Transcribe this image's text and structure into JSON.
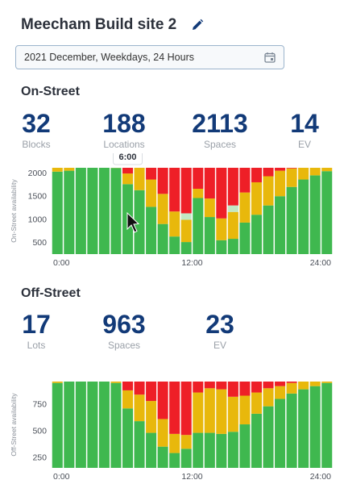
{
  "site": {
    "title": "Meecham Build site 2",
    "edit_icon": "pencil-icon"
  },
  "date_filter": {
    "value": "2021 December, Weekdays, 24 Hours",
    "icon": "calendar-icon"
  },
  "on_street": {
    "heading": "On-Street",
    "stats": [
      {
        "value": "32",
        "label": "Blocks"
      },
      {
        "value": "188",
        "label": "Locations"
      },
      {
        "value": "2113",
        "label": "Spaces"
      },
      {
        "value": "14",
        "label": "EV"
      }
    ],
    "tooltip": "6:00"
  },
  "off_street": {
    "heading": "Off-Street",
    "stats": [
      {
        "value": "17",
        "label": "Lots"
      },
      {
        "value": "963",
        "label": "Spaces"
      },
      {
        "value": "23",
        "label": "EV"
      }
    ]
  },
  "colors": {
    "green": "#3fb84f",
    "yellow": "#e8b80c",
    "red": "#ee1f27",
    "pink": "#f4b6bb",
    "lightgreen": "#c2e8c4",
    "navy": "#123a78"
  },
  "chart_data": [
    {
      "type": "bar",
      "stacked": true,
      "ylabel": "On-Street availability",
      "ylim": [
        250,
        2113
      ],
      "yticks": [
        500,
        1000,
        1500,
        2000
      ],
      "xticks": [
        "0:00",
        "12:00",
        "24:00"
      ],
      "categories": [
        "0",
        "1",
        "2",
        "3",
        "4",
        "5",
        "6",
        "7",
        "8",
        "9",
        "10",
        "11",
        "12",
        "13",
        "14",
        "15",
        "16",
        "17",
        "18",
        "19",
        "20",
        "21",
        "22",
        "23"
      ],
      "series": [
        {
          "values": [
            1780,
            1800,
            1890,
            1910,
            1890,
            1860,
            1510,
            1380,
            1020,
            650,
            380,
            260,
            1210,
            800,
            300,
            330,
            680,
            850,
            1050,
            1250,
            1450,
            1610,
            1700,
            1790
          ]
        },
        {
          "values": [
            100,
            90,
            90,
            100,
            100,
            120,
            230,
            510,
            590,
            650,
            540,
            480,
            200,
            400,
            470,
            580,
            650,
            700,
            630,
            550,
            400,
            260,
            190,
            120
          ]
        },
        {
          "values": [
            0,
            0,
            40,
            0,
            0,
            0,
            0,
            0,
            0,
            0,
            0,
            140,
            0,
            0,
            0,
            140,
            0,
            0,
            0,
            0,
            0,
            0,
            0,
            0
          ]
        },
        {
          "values": [
            43,
            63,
            33,
            73,
            73,
            83,
            373,
            223,
            503,
            813,
            1193,
            1233,
            703,
            913,
            1343,
            1063,
            783,
            563,
            433,
            313,
            263,
            243,
            223,
            203
          ]
        },
        {
          "values": [
            190,
            160,
            60,
            30,
            50,
            50,
            0,
            0,
            0,
            0,
            0,
            0,
            0,
            0,
            0,
            0,
            0,
            0,
            0,
            0,
            0,
            0,
            0,
            0
          ]
        }
      ]
    },
    {
      "type": "bar",
      "stacked": true,
      "ylabel": "Off-Street availability",
      "ylim": [
        150,
        963
      ],
      "yticks": [
        250,
        500,
        750,
        1000
      ],
      "xticks": [
        "0:00",
        "12:00",
        "24:00"
      ],
      "categories": [
        "0",
        "1",
        "2",
        "3",
        "4",
        "5",
        "6",
        "7",
        "8",
        "9",
        "10",
        "11",
        "12",
        "13",
        "14",
        "15",
        "16",
        "17",
        "18",
        "19",
        "20",
        "21",
        "22",
        "23"
      ],
      "series": [
        {
          "values": [
            800,
            830,
            850,
            850,
            850,
            800,
            560,
            440,
            330,
            200,
            140,
            180,
            330,
            330,
            320,
            340,
            410,
            510,
            580,
            650,
            700,
            740,
            770,
            800
          ]
        },
        {
          "values": [
            20,
            30,
            30,
            50,
            50,
            90,
            170,
            250,
            300,
            260,
            180,
            130,
            380,
            420,
            420,
            330,
            270,
            200,
            170,
            120,
            100,
            80,
            50,
            50
          ]
        },
        {
          "values": [
            143,
            103,
            83,
            63,
            63,
            73,
            233,
            273,
            333,
            503,
            643,
            653,
            253,
            213,
            223,
            293,
            283,
            253,
            213,
            193,
            163,
            143,
            143,
            113
          ]
        }
      ]
    }
  ]
}
